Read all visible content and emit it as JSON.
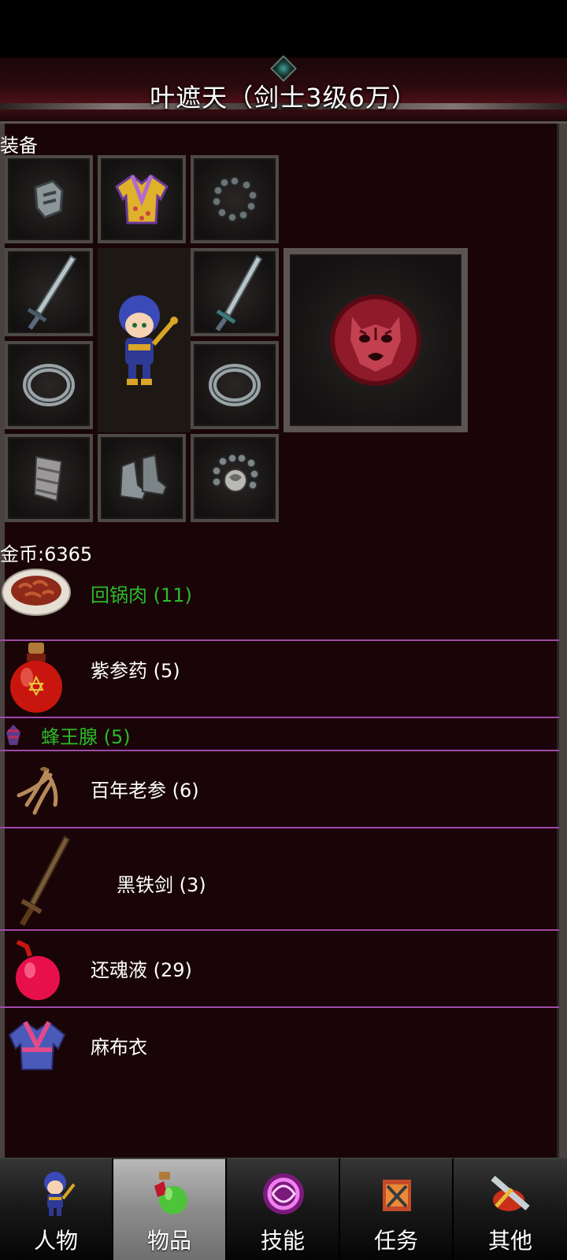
{
  "header": {
    "title": "叶遮天（剑士3级6万）"
  },
  "equipment": {
    "label": "装备",
    "slots": [
      "armguard-icon",
      "robe-icon",
      "necklace-icon",
      "sword-icon",
      "sword-icon",
      "ring-icon",
      "ring-icon",
      "bracer-icon",
      "boots-icon",
      "bead-necklace-icon"
    ],
    "badge": "tiger-medallion-icon"
  },
  "gold": {
    "text": "金币:6365"
  },
  "items": [
    {
      "name": "回锅肉 (11)",
      "color": "#2bbb2b",
      "icon": "meat-dish-icon"
    },
    {
      "name": "紫参药 (5)",
      "color": "#ffffff",
      "icon": "red-potion-icon"
    },
    {
      "name": "蜂王腺 (5)",
      "color": "#2bbb2b",
      "icon": "bee-gland-icon"
    },
    {
      "name": "百年老参 (6)",
      "color": "#ffffff",
      "icon": "ginseng-icon"
    },
    {
      "name": "黑铁剑 (3)",
      "color": "#ffffff",
      "icon": "iron-sword-icon"
    },
    {
      "name": "还魂液 (29)",
      "color": "#ffffff",
      "icon": "pink-potion-icon"
    },
    {
      "name": "麻布衣",
      "color": "#ffffff",
      "icon": "cloth-robe-icon"
    }
  ],
  "tabs": [
    {
      "label": "人物",
      "icon": "character-icon",
      "active": false
    },
    {
      "label": "物品",
      "icon": "items-icon",
      "active": true
    },
    {
      "label": "技能",
      "icon": "skills-icon",
      "active": false
    },
    {
      "label": "任务",
      "icon": "quests-icon",
      "active": false
    },
    {
      "label": "其他",
      "icon": "other-icon",
      "active": false
    }
  ],
  "colors": {
    "background": "#190507",
    "divider": "#a04aa8",
    "green_text": "#2bbb2b"
  }
}
